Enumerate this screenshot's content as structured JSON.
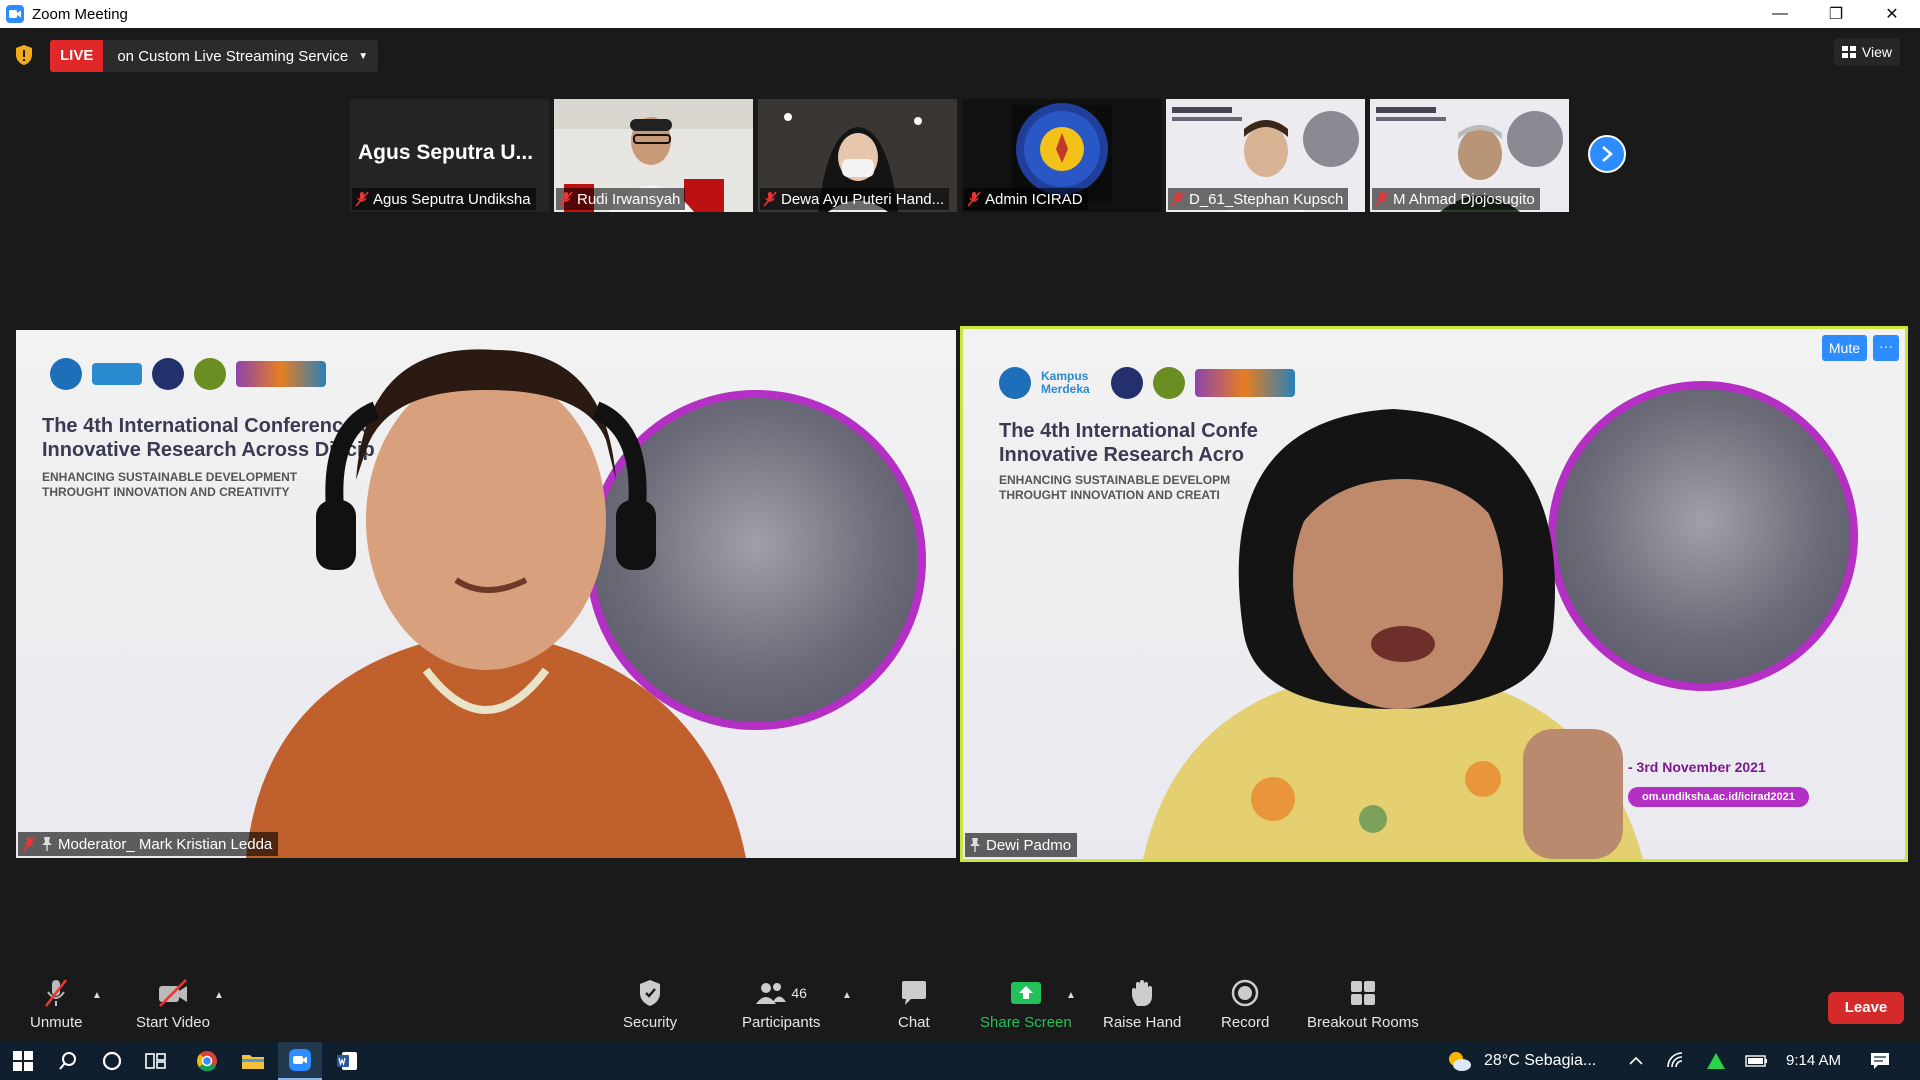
{
  "window": {
    "title": "Zoom Meeting",
    "minimize": "—",
    "restore": "❐",
    "close": "✕"
  },
  "topbar": {
    "live_badge": "LIVE",
    "live_service": "on Custom Live Streaming Service",
    "view_label": "View"
  },
  "thumbnails": [
    {
      "name_display": "Agus Seputra U...",
      "label": "Agus Seputra Undiksha",
      "video": false
    },
    {
      "label": "Rudi Irwansyah",
      "video": true
    },
    {
      "label": "Dewa Ayu Puteri Hand...",
      "video": true
    },
    {
      "label": "Admin ICIRAD",
      "video": true
    },
    {
      "label": "D_61_Stephan Kupsch",
      "video": true
    },
    {
      "label": "M Ahmad Djojosugito",
      "video": true
    }
  ],
  "main": {
    "left": {
      "label": "Moderator_ Mark Kristian Ledda",
      "slide_title_1": "The 4th International Conference o",
      "slide_title_2": "Innovative Research Across Discip",
      "slide_sub_1": "ENHANCING SUSTAINABLE DEVELOPMENT",
      "slide_sub_2": "THROUGHT INNOVATION AND CREATIVITY"
    },
    "right": {
      "label": "Dewi Padmo",
      "mute_label": "Mute",
      "more_label": "···",
      "logo_text": "Kampus Merdeka",
      "slide_title_1": "The 4th International Confe",
      "slide_title_2": "Innovative Research Acro",
      "slide_sub_1": "ENHANCING SUSTAINABLE DEVELOPM",
      "slide_sub_2": "THROUGHT INNOVATION AND CREATI",
      "date": "- 3rd November 2021",
      "url": "om.undiksha.ac.id/icirad2021"
    }
  },
  "toolbar": {
    "unmute": "Unmute",
    "start_video": "Start Video",
    "security": "Security",
    "participants": "Participants",
    "participants_count": "46",
    "chat": "Chat",
    "share_screen": "Share Screen",
    "raise_hand": "Raise Hand",
    "record": "Record",
    "breakout_rooms": "Breakout Rooms",
    "leave": "Leave"
  },
  "taskbar": {
    "weather": "28°C  Sebagia...",
    "time": "9:14 AM"
  },
  "colors": {
    "accent": "#2d8cff",
    "live_red": "#e02828",
    "leave_red": "#d42a2a",
    "active_speaker_border": "#c7e53a",
    "share_green": "#23c15a"
  }
}
